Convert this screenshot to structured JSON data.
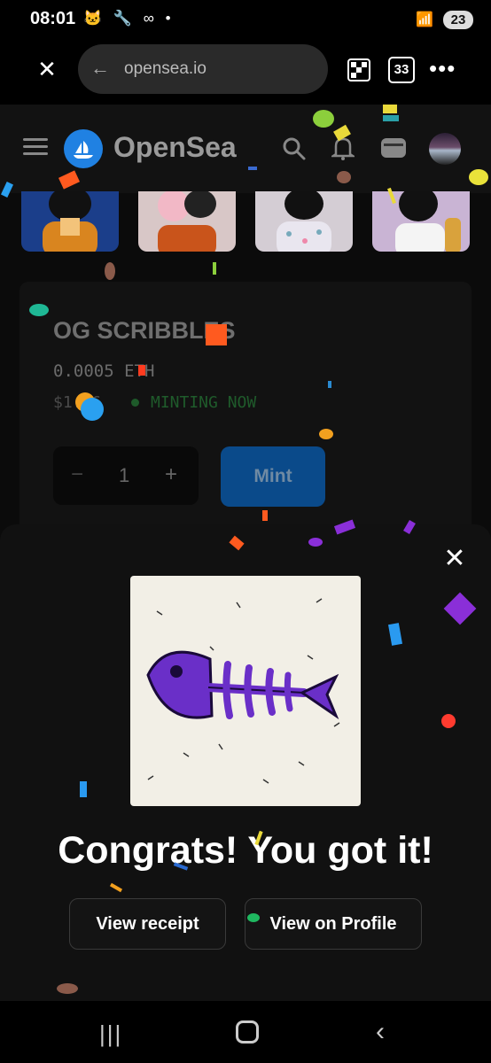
{
  "status_bar": {
    "time": "08:01",
    "notification_icons": "🐱 🔧 ∞ •",
    "battery": "23"
  },
  "browser": {
    "url": "opensea.io",
    "tab_count": "33"
  },
  "header": {
    "brand": "OpenSea"
  },
  "collection": {
    "title": "OG SCRIBBLES",
    "price": "0.0005 ETH",
    "usd": "$1.86",
    "status": "MINTING NOW",
    "quantity": "1",
    "mint_label": "Mint"
  },
  "modal": {
    "heading": "Congrats! You got it!",
    "view_receipt_label": "View receipt",
    "view_profile_label": "View on Profile"
  },
  "colors": {
    "accent": "#2081e2",
    "nft_fish": "#6a2fc8",
    "minting": "#1f5b2b"
  }
}
